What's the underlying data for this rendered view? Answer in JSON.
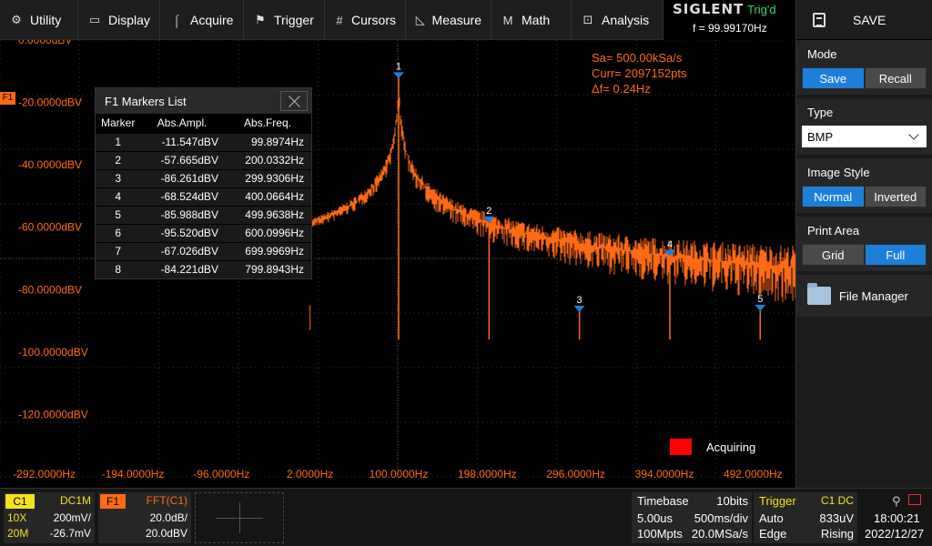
{
  "menu": [
    {
      "icon": "gear-icon",
      "label": "Utility"
    },
    {
      "icon": "display-icon",
      "label": "Display"
    },
    {
      "icon": "acquire-icon",
      "label": "Acquire"
    },
    {
      "icon": "trigger-icon",
      "label": "Trigger"
    },
    {
      "icon": "cursors-icon",
      "label": "Cursors"
    },
    {
      "icon": "measure-icon",
      "label": "Measure"
    },
    {
      "icon": "math-icon",
      "label": "Math"
    },
    {
      "icon": "analysis-icon",
      "label": "Analysis"
    }
  ],
  "brand": {
    "logo": "SIGLENT",
    "trig_status": "Trig'd",
    "frequency": "f = 99.99170Hz"
  },
  "right_panel": {
    "title": "SAVE",
    "mode": {
      "label": "Mode",
      "options": [
        "Save",
        "Recall"
      ],
      "active": "Save"
    },
    "type": {
      "label": "Type",
      "value": "BMP"
    },
    "image_style": {
      "label": "Image Style",
      "options": [
        "Normal",
        "Inverted"
      ],
      "active": "Normal"
    },
    "print_area": {
      "label": "Print Area",
      "options": [
        "Grid",
        "Full"
      ],
      "active": "Full"
    },
    "file_manager": "File Manager"
  },
  "markers_list": {
    "title": "F1 Markers List",
    "columns": [
      "Marker",
      "Abs.Ampl.",
      "Abs.Freq."
    ],
    "rows": [
      [
        "1",
        "-11.547dBV",
        "99.8974Hz"
      ],
      [
        "2",
        "-57.665dBV",
        "200.0332Hz"
      ],
      [
        "3",
        "-86.261dBV",
        "299.9306Hz"
      ],
      [
        "4",
        "-68.524dBV",
        "400.0664Hz"
      ],
      [
        "5",
        "-85.988dBV",
        "499.9638Hz"
      ],
      [
        "6",
        "-95.520dBV",
        "600.0996Hz"
      ],
      [
        "7",
        "-67.026dBV",
        "699.9969Hz"
      ],
      [
        "8",
        "-84.221dBV",
        "799.8943Hz"
      ]
    ]
  },
  "fft_info": {
    "sa": "Sa=  500.00kSa/s",
    "curr": "Curr= 2097152pts",
    "df": "Δf=  0.24Hz"
  },
  "channel_tag": "F1",
  "acquiring": "Acquiring",
  "colors": {
    "trace": "#ff6a13",
    "accent": "#1d7fd9",
    "trig_green": "#3cd66b",
    "c1_yellow": "#f5e11e"
  },
  "chart_data": {
    "type": "line",
    "x_ticks": [
      "-292.0000Hz",
      "-194.0000Hz",
      "-96.0000Hz",
      "2.0000Hz",
      "100.0000Hz",
      "198.0000Hz",
      "296.0000Hz",
      "394.0000Hz",
      "492.0000Hz"
    ],
    "y_ticks": [
      "0.0000dBV",
      "-20.0000dBV",
      "-40.0000dBV",
      "-60.0000dBV",
      "-80.0000dBV",
      "-100.0000dBV",
      "-120.0000dBV"
    ],
    "xlim": [
      -341,
      539
    ],
    "ylim": [
      -140,
      0
    ],
    "markers": [
      {
        "label": "1",
        "x": 99.9,
        "y": -11.5
      },
      {
        "label": "2",
        "x": 200.0,
        "y": -57.7
      },
      {
        "label": "3",
        "x": 299.9,
        "y": -86.3
      },
      {
        "label": "4",
        "x": 400.1,
        "y": -68.5
      },
      {
        "label": "5",
        "x": 500.0,
        "y": -86.0
      }
    ],
    "spectrum": {
      "start": 2,
      "floor_start": -90,
      "floor_end": -108,
      "peaks": [
        [
          100,
          -11.5
        ],
        [
          200,
          -57.7
        ],
        [
          300,
          -86.3
        ],
        [
          400,
          -68.5
        ],
        [
          500,
          -86.0
        ]
      ]
    }
  },
  "bottom": {
    "c1": {
      "tag": "C1",
      "coupling": "DC1M",
      "probe": "10X",
      "scale": "200mV/",
      "bw": "20M",
      "offset": "-26.7mV"
    },
    "f1": {
      "tag": "F1",
      "source": "FFT(C1)",
      "scale": "20.0dB/",
      "ref": "20.0dBV"
    },
    "timebase": {
      "label": "Timebase",
      "bits": "10bits",
      "delay": "5.00us",
      "scale": "500ms/div",
      "mpts": "100Mpts",
      "rate": "20.0MSa/s"
    },
    "trigger": {
      "label": "Trigger",
      "source": "C1 DC",
      "mode": "Auto",
      "level": "833uV",
      "type": "Edge",
      "slope": "Rising"
    },
    "clock": {
      "time": "18:00:21",
      "date": "2022/12/27"
    }
  }
}
